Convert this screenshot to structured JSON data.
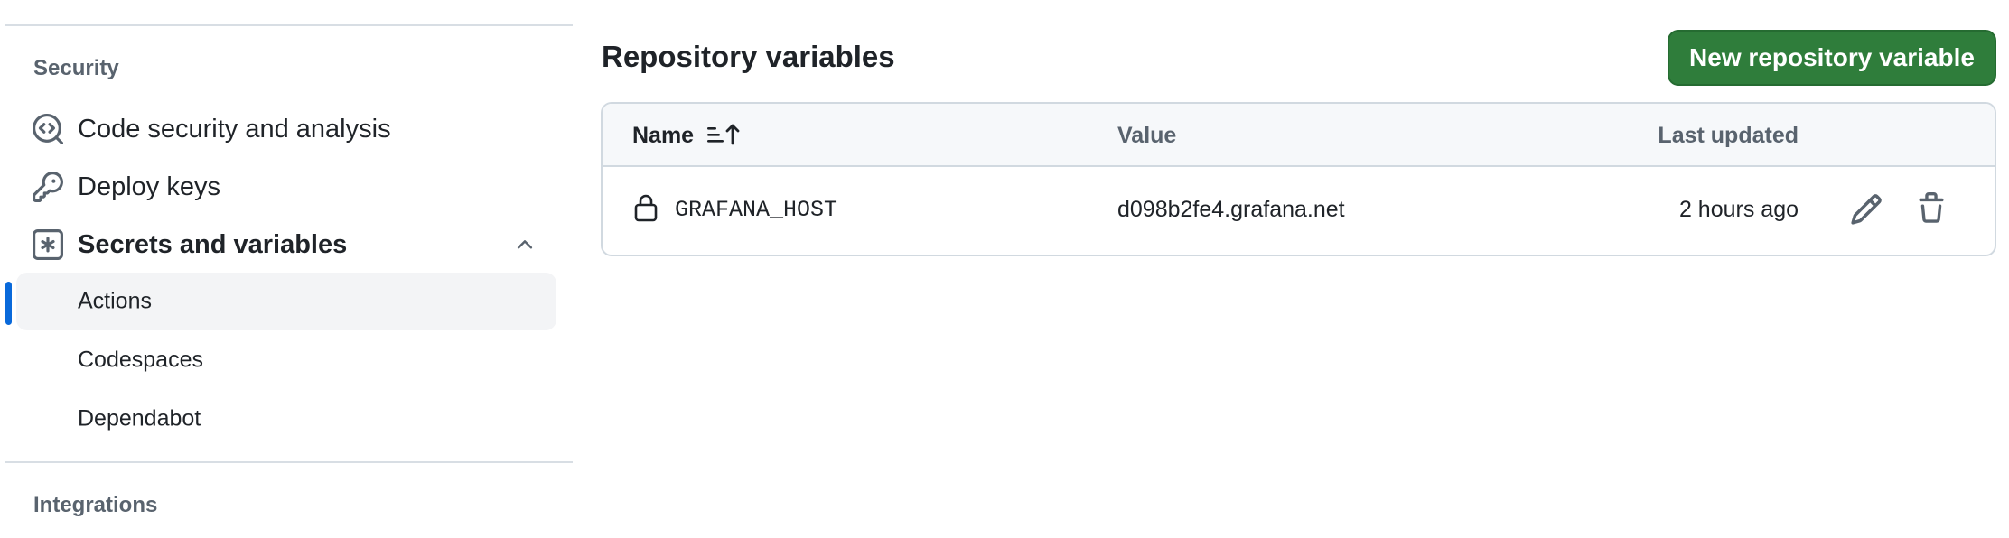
{
  "sidebar": {
    "security_heading": "Security",
    "items": [
      {
        "label": "Code security and analysis",
        "icon": "codescan-icon"
      },
      {
        "label": "Deploy keys",
        "icon": "key-icon"
      },
      {
        "label": "Secrets and variables",
        "icon": "key-asterisk-icon",
        "expanded": true
      }
    ],
    "sub_items": [
      {
        "label": "Actions",
        "active": true
      },
      {
        "label": "Codespaces",
        "active": false
      },
      {
        "label": "Dependabot",
        "active": false
      }
    ],
    "integrations_heading": "Integrations"
  },
  "main": {
    "title": "Repository variables",
    "new_button_label": "New repository variable",
    "table": {
      "headers": {
        "name": "Name",
        "value": "Value",
        "last_updated": "Last updated"
      },
      "rows": [
        {
          "name": "GRAFANA_HOST",
          "value": "d098b2fe4.grafana.net",
          "last_updated": "2 hours ago"
        }
      ]
    }
  },
  "colors": {
    "accent": "#0969da",
    "primary_button": "#2f7d3b",
    "active_bg": "#f3f4f6"
  }
}
